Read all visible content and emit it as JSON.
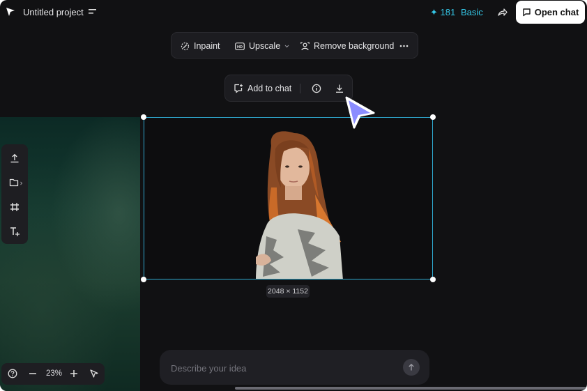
{
  "header": {
    "project_title": "Untitled project",
    "credits": "181",
    "plan": "Basic",
    "open_chat_label": "Open chat",
    "icons": [
      "logo-icon",
      "menu-icon",
      "sparkle-icon",
      "share-icon",
      "chat-bubble-icon"
    ]
  },
  "toolbar": {
    "inpaint_label": "Inpaint",
    "upscale_label": "Upscale",
    "remove_bg_label": "Remove background",
    "icons": [
      "inpaint-icon",
      "hd-icon",
      "chevron-down-icon",
      "remove-background-icon",
      "more-icon"
    ]
  },
  "subbar": {
    "add_to_chat_label": "Add to chat",
    "icons": [
      "add-to-chat-icon",
      "info-icon",
      "download-icon"
    ]
  },
  "canvas": {
    "dimensions": "2048 × 1152"
  },
  "left_tools": {
    "icons": [
      "upload-icon",
      "folder-icon",
      "crop-icon",
      "add-text-icon"
    ]
  },
  "zoom": {
    "value": "23%",
    "icons": [
      "help-icon",
      "zoom-out-icon",
      "zoom-in-icon",
      "pointer-icon"
    ]
  },
  "prompt": {
    "placeholder": "Describe your idea",
    "icons": [
      "send-icon"
    ]
  },
  "colors": {
    "accent": "#34c6e6",
    "selection": "#2fa9cf",
    "cursor": "#8b8dff",
    "background": "#111113"
  }
}
